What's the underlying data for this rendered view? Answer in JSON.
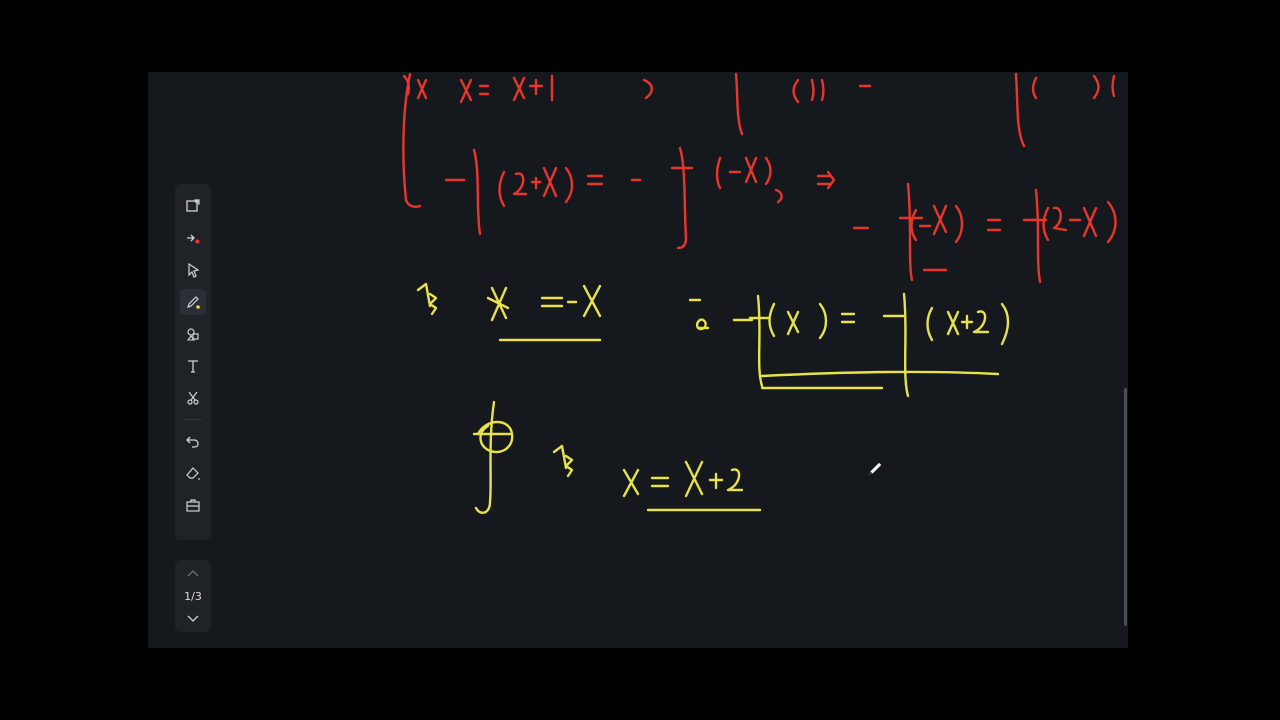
{
  "toolbar": {
    "items": [
      {
        "name": "new-page-icon",
        "active": false
      },
      {
        "name": "laser-pointer-icon",
        "active": false
      },
      {
        "name": "select-pointer-icon",
        "active": false
      },
      {
        "name": "pen-icon",
        "active": true
      },
      {
        "name": "shapes-icon",
        "active": false
      },
      {
        "name": "text-icon",
        "active": false
      },
      {
        "name": "scissors-icon",
        "active": false
      },
      {
        "name": "undo-icon",
        "active": false
      },
      {
        "name": "eraser-icon",
        "active": false
      },
      {
        "name": "toolbox-icon",
        "active": false
      }
    ]
  },
  "pager": {
    "page_label": "1/3"
  },
  "colors": {
    "background": "#15181c",
    "toolbar": "#1f2227",
    "ink_red": "#e8362e",
    "ink_yellow": "#e8e24a",
    "pen_accent": "#f2d24a",
    "laser_accent": "#e8362e"
  }
}
